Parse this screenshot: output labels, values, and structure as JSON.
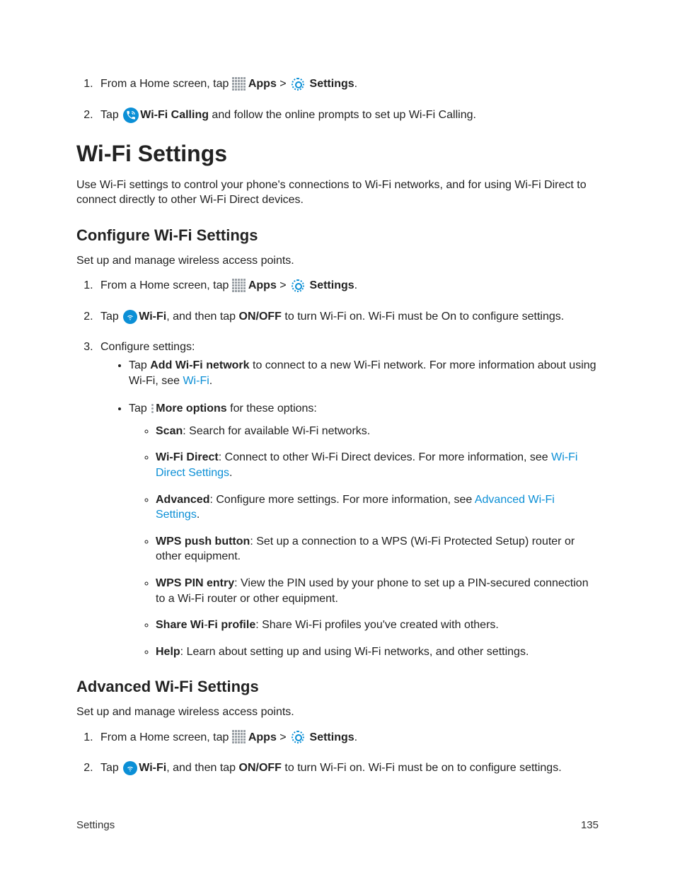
{
  "step_home_tap": "From a Home screen, tap ",
  "apps_label": "Apps",
  "gt": " > ",
  "settings_label": "Settings",
  "period": ".",
  "step_tap": "Tap ",
  "wifi_calling_label": "Wi-Fi Calling",
  "wifi_calling_follow": " and follow the online prompts to set up Wi-Fi Calling.",
  "h1_wifi_settings": "Wi-Fi Settings",
  "wifi_settings_intro": "Use Wi-Fi settings to control your phone's connections to Wi-Fi networks, and for using Wi-Fi Direct to connect directly to other Wi-Fi Direct devices.",
  "h2_configure": "Configure Wi-Fi Settings",
  "configure_intro": "Set up and manage wireless access points.",
  "wifi_label": "Wi-Fi",
  "then_tap": ", and then tap ",
  "onoff_label": "ON/OFF",
  "onoff_rest_on_cap": " to turn Wi-Fi on. Wi-Fi must be On to configure settings.",
  "configure_step3": "Configure settings:",
  "add_wifi_network": "Add Wi-Fi network",
  "add_wifi_rest": " to connect to a new Wi-Fi network. For more information about using Wi-Fi, see ",
  "wifi_link": "Wi-Fi",
  "more_options_label": "More options",
  "more_options_rest": " for these options:",
  "scan_label": "Scan",
  "scan_rest": ": Search for available Wi-Fi networks.",
  "wifi_direct_label": "Wi-Fi Direct",
  "wifi_direct_rest_a": ": Connect to other Wi-Fi Direct devices. For more information, see ",
  "wifi_direct_link": "Wi-Fi Direct Settings",
  "advanced_label": "Advanced",
  "advanced_rest_a": ": Configure more settings. For more information, see ",
  "advanced_link": "Advanced Wi-Fi Settings",
  "wps_push_label": "WPS push button",
  "wps_push_rest": ": Set up a connection to a WPS (Wi-Fi Protected Setup) router or other equipment.",
  "wps_pin_label": "WPS PIN entry",
  "wps_pin_rest": ": View the PIN used by your phone to set up a PIN-secured connection to a Wi-Fi router or other equipment.",
  "share_label": "Share Wi",
  "share_hyphen": "-",
  "share_label_b": "Fi profile",
  "share_rest": ": Share Wi-Fi profiles you've created with others.",
  "help_label": "Help",
  "help_rest": ": Learn about setting up and using Wi-Fi networks, and other settings.",
  "h2_advanced": "Advanced Wi-Fi Settings",
  "advanced_intro": "Set up and manage wireless access points.",
  "onoff_rest_on_lc": " to turn Wi-Fi on. Wi-Fi must be on to configure settings.",
  "footer_left": "Settings",
  "footer_right": "135"
}
